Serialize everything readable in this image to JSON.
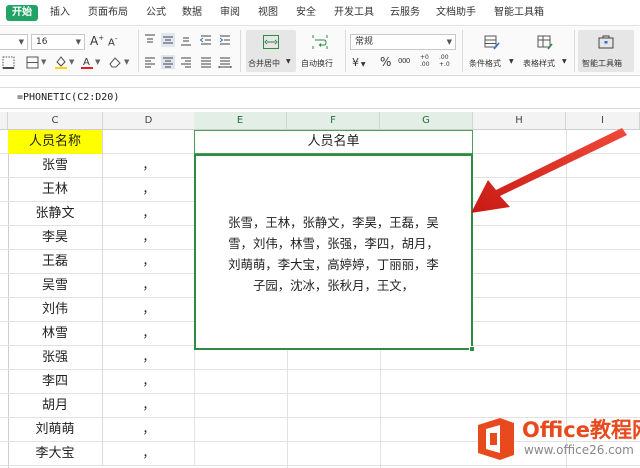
{
  "menu": {
    "tabs": [
      "开始",
      "插入",
      "页面布局",
      "公式",
      "数据",
      "审阅",
      "视图",
      "安全",
      "开发工具",
      "云服务",
      "文档助手",
      "智能工具箱"
    ],
    "active_index": 0,
    "active_color": "#21a366"
  },
  "ribbon": {
    "font_size": "16",
    "number_format": "常规",
    "merge_center": "合并居中",
    "wrap_text": "自动换行",
    "conditional_format": "条件格式",
    "table_style": "表格样式",
    "smart_toolbox": "智能工具箱",
    "percent_symbol": "%",
    "yen_symbol": "¥",
    "thousands_symbol": "000",
    "inc_decimal": "+0 .00",
    "dec_decimal": ".00 +.0"
  },
  "formula_bar": {
    "formula": "=PHONETIC(C2:D20)"
  },
  "columns": [
    "C",
    "D",
    "E",
    "F",
    "G",
    "H",
    "I"
  ],
  "selected_columns": [
    "E",
    "F",
    "G"
  ],
  "header_row": {
    "name_header": "人员名称",
    "list_title": "人员名单",
    "header_fill": "#ffff00"
  },
  "names": [
    "张雪",
    "王林",
    "张静文",
    "李昊",
    "王磊",
    "吴雪",
    "刘伟",
    "林雪",
    "张强",
    "李四",
    "胡月",
    "刘萌萌",
    "李大宝"
  ],
  "separator": "，",
  "result": {
    "lines": [
      "张雪，王林，张静文，李昊，王磊，吴",
      "雪，刘伟，林雪，张强，李四，胡月，",
      "刘萌萌，李大宝，高婷婷，丁丽丽，李",
      "子园，沈冰，张秋月，王文，"
    ],
    "border_color": "#2f8a43"
  },
  "annotation": {
    "arrow_color": "#e02020"
  },
  "watermark": {
    "brand": "Office教程网",
    "url": "www.office26.com",
    "brand_color": "#e8491d"
  }
}
